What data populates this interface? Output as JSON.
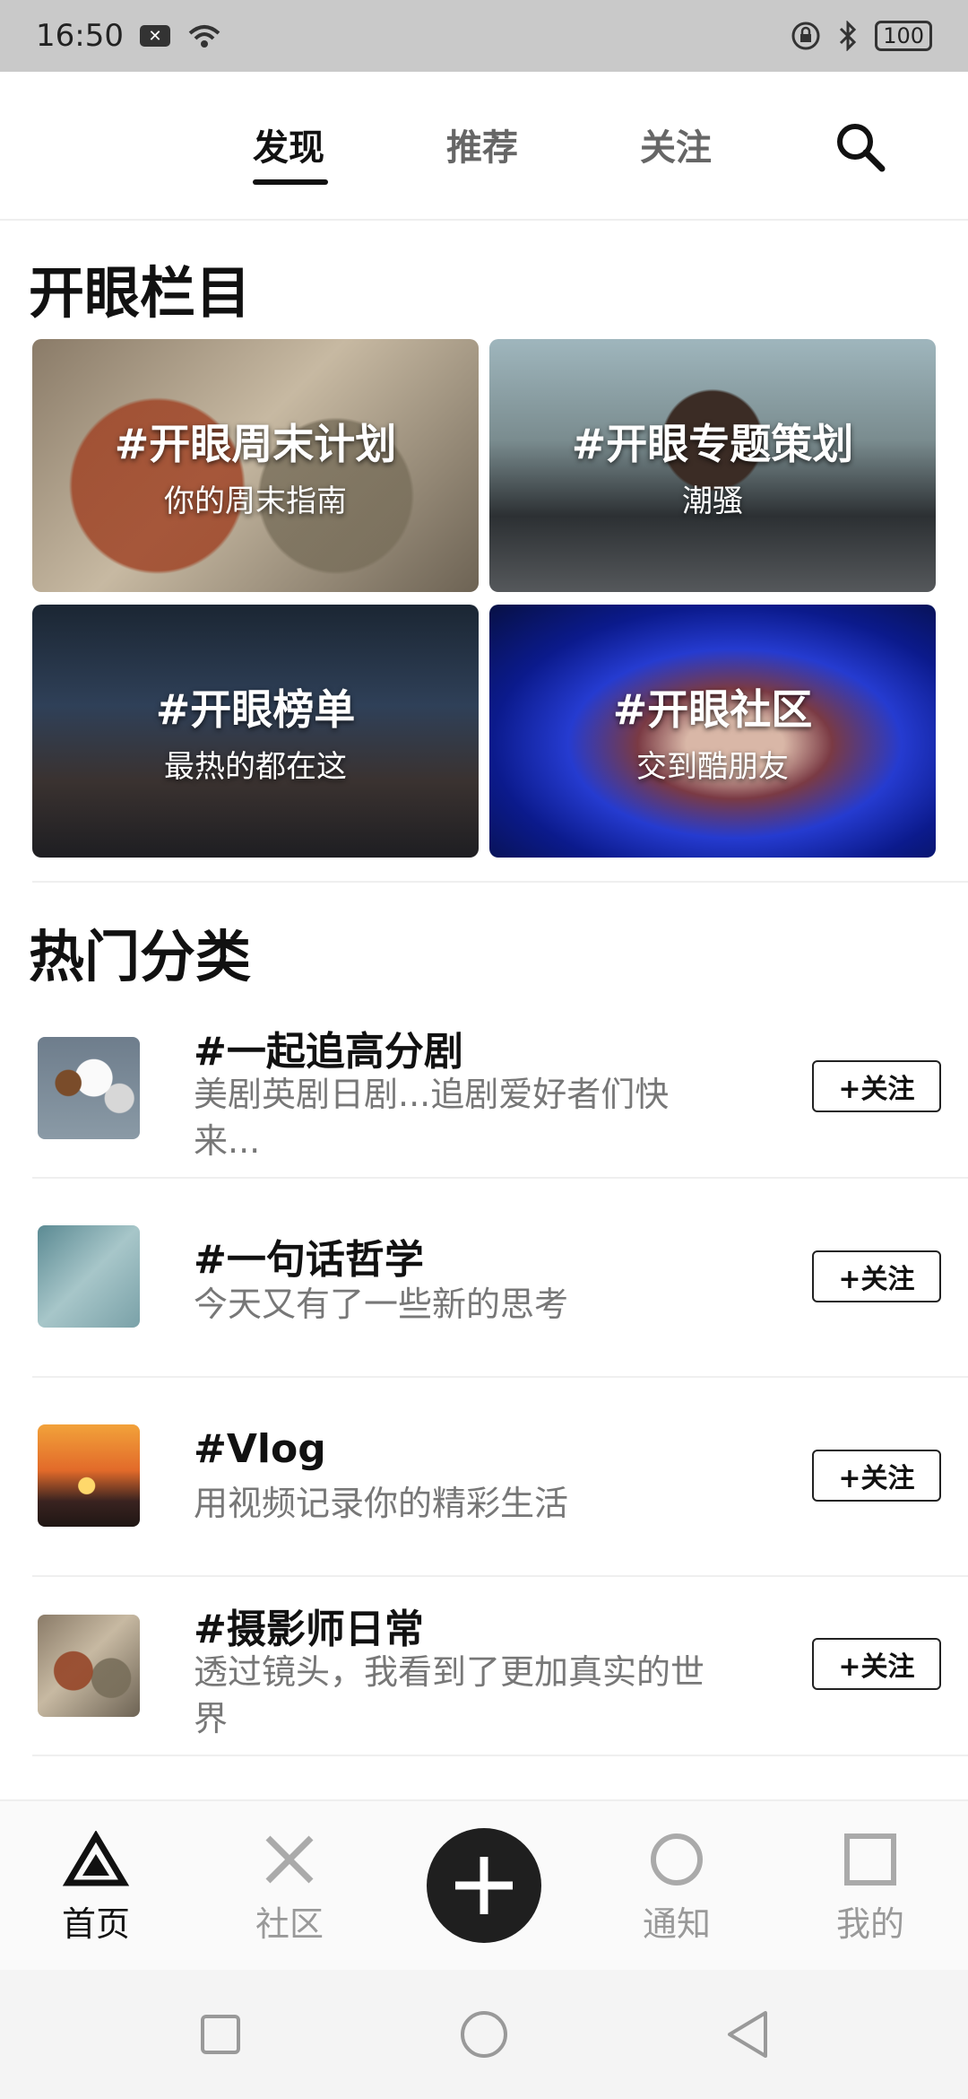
{
  "status_bar": {
    "time": "16:50",
    "battery": "100"
  },
  "top_nav": {
    "tabs": [
      {
        "label": "发现",
        "active": true
      },
      {
        "label": "推荐",
        "active": false
      },
      {
        "label": "关注",
        "active": false
      }
    ],
    "search_icon": "search-icon"
  },
  "section_columns": {
    "title": "开眼栏目",
    "cards": [
      {
        "title": "#开眼周末计划",
        "subtitle": "你的周末指南"
      },
      {
        "title": "#开眼专题策划",
        "subtitle": "潮骚"
      },
      {
        "title": "#开眼榜单",
        "subtitle": "最热的都在这"
      },
      {
        "title": "#开眼社区",
        "subtitle": "交到酷朋友"
      }
    ]
  },
  "section_hot": {
    "title": "热门分类",
    "items": [
      {
        "title": "#一起追高分剧",
        "desc": "美剧英剧日剧...追剧爱好者们快来...",
        "follow": "+关注"
      },
      {
        "title": "#一句话哲学",
        "desc": "今天又有了一些新的思考",
        "follow": "+关注"
      },
      {
        "title": "#Vlog",
        "desc": "用视频记录你的精彩生活",
        "follow": "+关注"
      },
      {
        "title": "#摄影师日常",
        "desc": "透过镜头，我看到了更加真实的世界",
        "follow": "+关注"
      }
    ]
  },
  "next_section_title_cut": "热门分类",
  "bottom_nav": {
    "items": [
      {
        "label": "首页",
        "icon": "triangle-icon",
        "active": true
      },
      {
        "label": "社区",
        "icon": "cross-icon",
        "active": false
      },
      {
        "label": "",
        "icon": "plus-icon",
        "active": false
      },
      {
        "label": "通知",
        "icon": "circle-icon",
        "active": false
      },
      {
        "label": "我的",
        "icon": "square-icon",
        "active": false
      }
    ]
  },
  "system_nav": {
    "icons": [
      "square-icon",
      "circle-icon",
      "back-triangle-icon"
    ]
  }
}
